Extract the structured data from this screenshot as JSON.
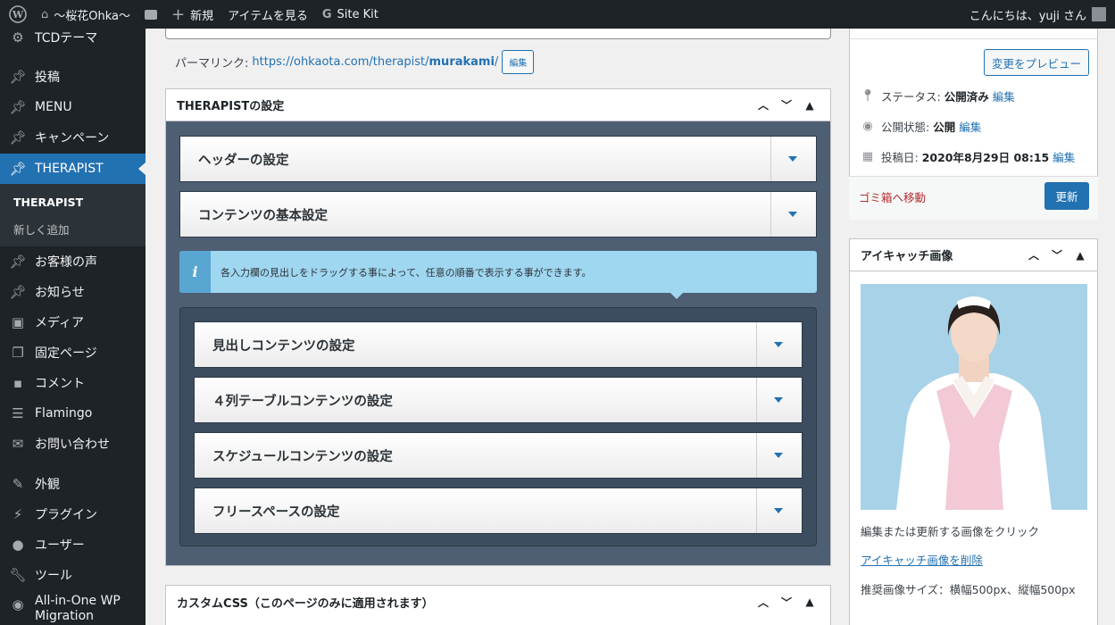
{
  "admin_bar": {
    "site_name": "〜桜花Ohka〜",
    "new_label": "新規",
    "view_label": "アイテムを見る",
    "sitekit_label": "Site Kit",
    "greeting": "こんにちは、yuji さん"
  },
  "sidebar": {
    "items": [
      {
        "label": "TCDテーマ",
        "icon": "gear-icon"
      },
      {
        "label": "投稿",
        "icon": "pin-icon"
      },
      {
        "label": "MENU",
        "icon": "pin-icon"
      },
      {
        "label": "キャンペーン",
        "icon": "pin-icon"
      },
      {
        "label": "THERAPIST",
        "icon": "pin-icon",
        "current": true
      },
      {
        "label": "お客様の声",
        "icon": "pin-icon"
      },
      {
        "label": "お知らせ",
        "icon": "pin-icon"
      },
      {
        "label": "メディア",
        "icon": "media-icon"
      },
      {
        "label": "固定ページ",
        "icon": "page-icon"
      },
      {
        "label": "コメント",
        "icon": "comment-icon"
      },
      {
        "label": "Flamingo",
        "icon": "flamingo-icon"
      },
      {
        "label": "お問い合わせ",
        "icon": "mail-icon"
      },
      {
        "label": "外観",
        "icon": "brush-icon"
      },
      {
        "label": "プラグイン",
        "icon": "plugin-icon"
      },
      {
        "label": "ユーザー",
        "icon": "user-icon"
      },
      {
        "label": "ツール",
        "icon": "wrench-icon"
      },
      {
        "label": "All-in-One WP",
        "icon": "migration-icon"
      }
    ],
    "item_last_line2": "Migration",
    "submenu": {
      "title": "THERAPIST",
      "add_new": "新しく追加"
    }
  },
  "permalink": {
    "label": "パーマリンク:",
    "url_prefix": "https://ohkaota.com/therapist/",
    "url_slug": "murakami",
    "url_suffix": "/",
    "edit": "編集"
  },
  "therapist_box": {
    "title": "THERAPISTの設定",
    "accordions": [
      "ヘッダーの設定",
      "コンテンツの基本設定"
    ],
    "info": "各入力欄の見出しをドラッグする事によって、任意の順番で表示する事ができます。",
    "inner_accordions": [
      "見出しコンテンツの設定",
      "４列テーブルコンテンツの設定",
      "スケジュールコンテンツの設定",
      "フリースペースの設定"
    ]
  },
  "css_box": {
    "title": "カスタムCSS（このページのみに適用されます）"
  },
  "publish": {
    "preview": "変更をプレビュー",
    "status_label": "ステータス:",
    "status_value": "公開済み",
    "visibility_label": "公開状態:",
    "visibility_value": "公開",
    "date_label": "投稿日:",
    "date_value": "2020年8月29日 08:15",
    "edit": "編集",
    "trash": "ゴミ箱へ移動",
    "update": "更新"
  },
  "featured": {
    "title": "アイキャッチ画像",
    "hint": "編集または更新する画像をクリック",
    "remove": "アイキャッチ画像を削除",
    "size": "推奨画像サイズ：横幅500px、縦幅500px"
  },
  "colors": {
    "accent": "#2271b1",
    "sidebar": "#1d2327",
    "panel": "#4e5e73",
    "info": "#9fd6f0"
  }
}
